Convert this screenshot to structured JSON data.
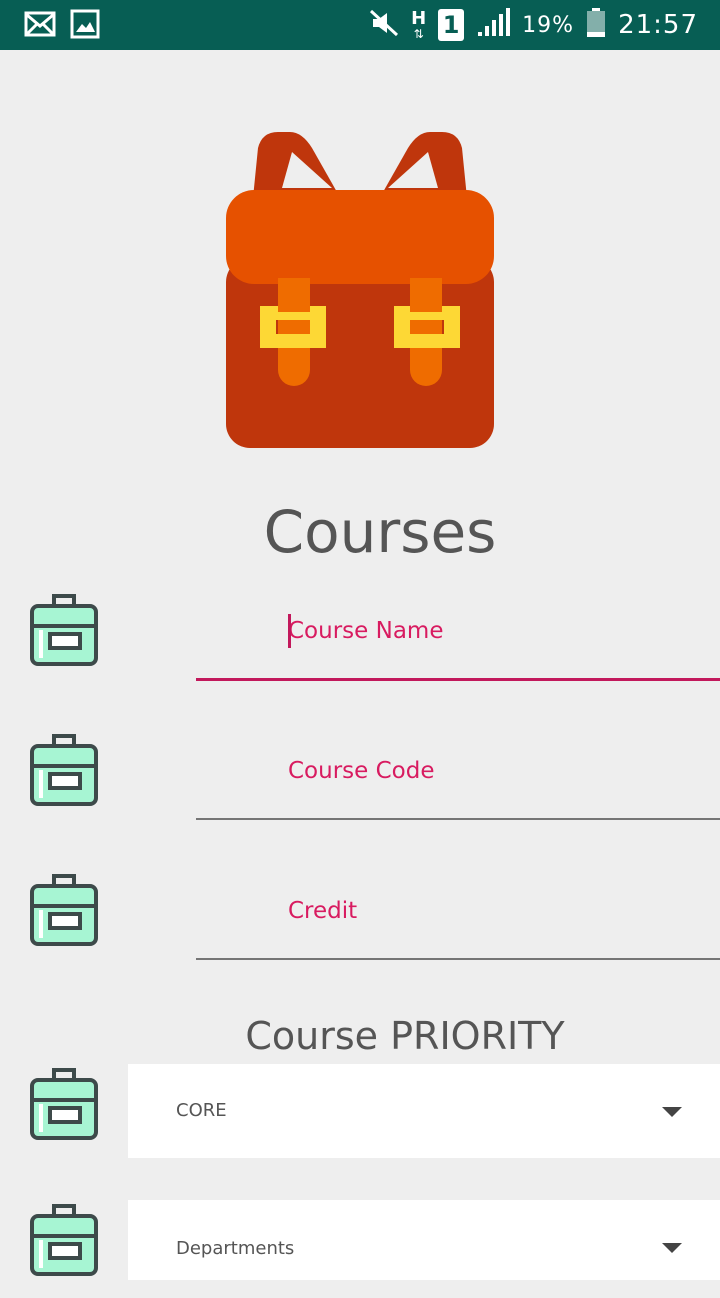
{
  "status_bar": {
    "left_icons": [
      "mail-icon",
      "image-icon"
    ],
    "network_type": "H",
    "sim_slot": "1",
    "battery": "19%",
    "time": "21:57"
  },
  "page": {
    "title": "Courses",
    "hero_icon": "backpack-icon"
  },
  "form": {
    "course_name_placeholder": "Course Name",
    "course_code_placeholder": "Course Code",
    "credit_placeholder": "Credit",
    "priority_label": "Course PRIORITY",
    "priority_selected": "CORE",
    "department_selected": "Departments"
  },
  "colors": {
    "status_bar": "#075e54",
    "accent": "#d81b60",
    "background": "#eeeeee",
    "field_icon": "#a7f5d3"
  }
}
